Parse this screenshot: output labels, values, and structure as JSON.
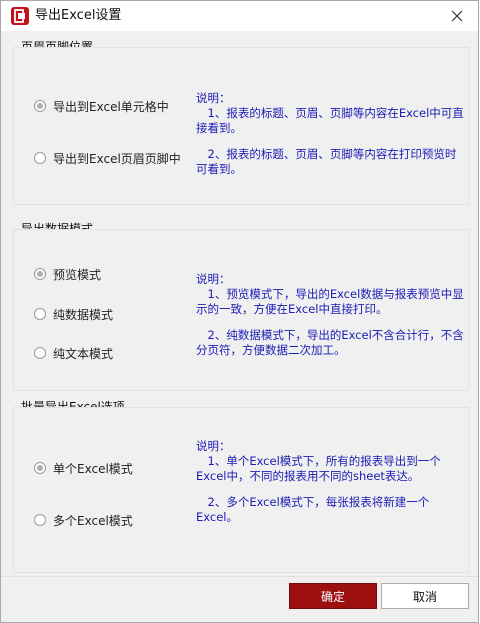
{
  "window": {
    "title": "导出Excel设置",
    "close_icon": "close-icon",
    "app_icon": "app-logo-icon",
    "accent": "#c8101e"
  },
  "sections": [
    {
      "title": "页眉页脚位置",
      "options": [
        {
          "label": "导出到Excel单元格中",
          "checked": true
        },
        {
          "label": "导出到Excel页眉页脚中",
          "checked": false
        }
      ],
      "description": [
        "说明：",
        "　1、报表的标题、页眉、页脚等内容在Excel中可直接看到。",
        "　2、报表的标题、页眉、页脚等内容在打印预览时可看到。"
      ]
    },
    {
      "title": "导出数据模式",
      "options": [
        {
          "label": "预览模式",
          "checked": true
        },
        {
          "label": "纯数据模式",
          "checked": false
        },
        {
          "label": "纯文本模式",
          "checked": false
        }
      ],
      "description": [
        "说明：",
        "　1、预览模式下，导出的Excel数据与报表预览中显示的一致，方便在Excel中直接打印。",
        "　2、纯数据模式下，导出的Excel不含合计行，不含分页符，方便数据二次加工。"
      ]
    },
    {
      "title": "批量导出Excel选项",
      "options": [
        {
          "label": "单个Excel模式",
          "checked": true
        },
        {
          "label": "多个Excel模式",
          "checked": false
        }
      ],
      "description": [
        "说明：",
        "　1、单个Excel模式下，所有的报表导出到一个Excel中，不同的报表用不同的sheet表达。",
        "　2、多个Excel模式下，每张报表将新建一个Excel。"
      ]
    }
  ],
  "buttons": {
    "ok": "确定",
    "cancel": "取消",
    "ok_color": "#9c1010"
  },
  "colors": {
    "description_text": "#1b1bb5",
    "dialog_bg": "#f0f0f0"
  }
}
